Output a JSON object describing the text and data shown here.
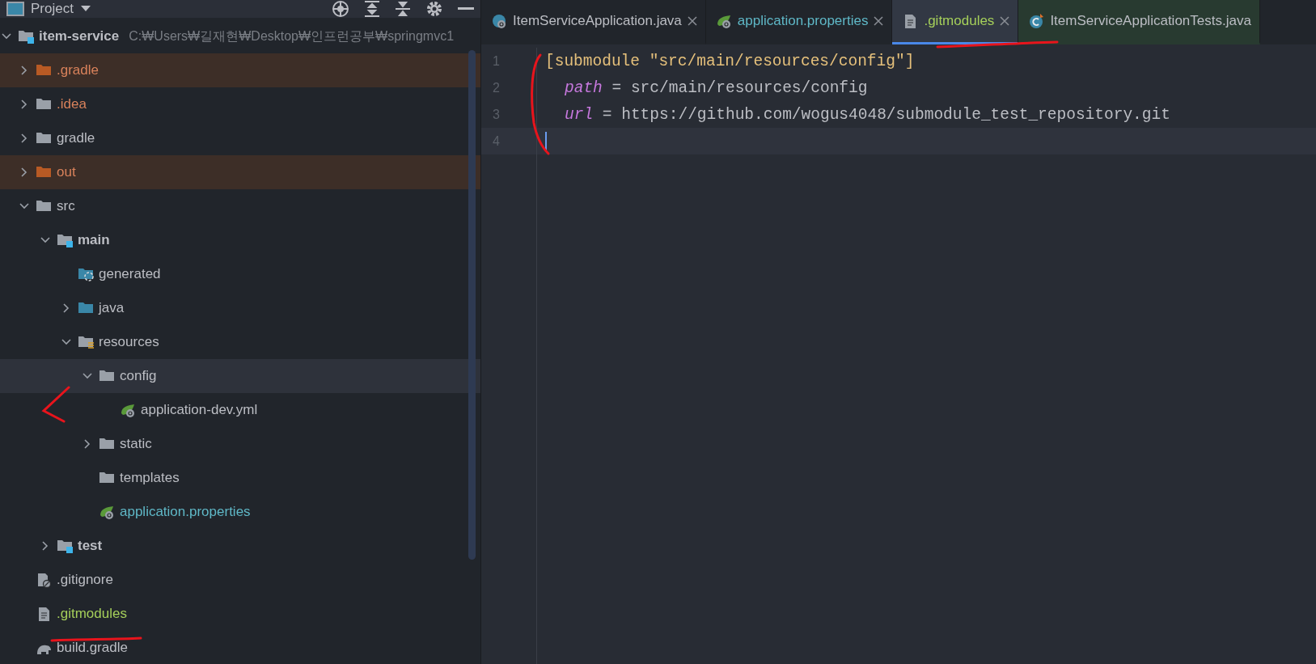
{
  "project_panel": {
    "title": "Project",
    "tree": [
      {
        "name": "item-service",
        "kind": "module",
        "hint": "C:₩Users₩길재현₩Desktop₩인프런공부₩springmvc1",
        "expanded": true,
        "selected": false,
        "excluded": false,
        "color": "#bcbec4",
        "children": [
          {
            "name": ".gradle",
            "kind": "excluded-folder",
            "expanded": false,
            "selected": false,
            "excluded": true,
            "color": "#d9825b"
          },
          {
            "name": ".idea",
            "kind": "folder",
            "expanded": false,
            "selected": false,
            "excluded": false,
            "color": "#d9825b"
          },
          {
            "name": "gradle",
            "kind": "folder",
            "expanded": false,
            "selected": false,
            "excluded": false,
            "color": "#bcbec4"
          },
          {
            "name": "out",
            "kind": "excluded-folder",
            "expanded": false,
            "selected": false,
            "excluded": true,
            "color": "#d9825b"
          },
          {
            "name": "src",
            "kind": "folder",
            "expanded": true,
            "selected": false,
            "excluded": false,
            "color": "#bcbec4",
            "children": [
              {
                "name": "main",
                "kind": "module",
                "expanded": true,
                "selected": false,
                "excluded": false,
                "color": "#bcbec4",
                "children": [
                  {
                    "name": "generated",
                    "kind": "generated-folder",
                    "selected": false,
                    "excluded": false,
                    "color": "#bcbec4"
                  },
                  {
                    "name": "java",
                    "kind": "source-folder",
                    "expanded": false,
                    "selected": false,
                    "excluded": false,
                    "color": "#bcbec4"
                  },
                  {
                    "name": "resources",
                    "kind": "resource-folder",
                    "expanded": true,
                    "selected": false,
                    "excluded": false,
                    "color": "#bcbec4",
                    "children": [
                      {
                        "name": "config",
                        "kind": "folder",
                        "expanded": true,
                        "selected": true,
                        "excluded": false,
                        "color": "#bcbec4",
                        "children": [
                          {
                            "name": "application-dev.yml",
                            "kind": "spring-file",
                            "selected": false,
                            "excluded": false,
                            "color": "#bcbec4"
                          }
                        ]
                      },
                      {
                        "name": "static",
                        "kind": "folder",
                        "expanded": false,
                        "selected": false,
                        "excluded": false,
                        "color": "#bcbec4"
                      },
                      {
                        "name": "templates",
                        "kind": "folder",
                        "selected": false,
                        "excluded": false,
                        "color": "#bcbec4"
                      },
                      {
                        "name": "application.properties",
                        "kind": "spring-file",
                        "selected": false,
                        "excluded": false,
                        "color": "#5fb8c7"
                      }
                    ]
                  }
                ]
              },
              {
                "name": "test",
                "kind": "module",
                "expanded": false,
                "selected": false,
                "excluded": false,
                "color": "#bcbec4"
              }
            ]
          },
          {
            "name": ".gitignore",
            "kind": "gitignore-file",
            "selected": false,
            "excluded": false,
            "color": "#bcbec4"
          },
          {
            "name": ".gitmodules",
            "kind": "text-file",
            "selected": false,
            "excluded": false,
            "color": "#a5cf5a"
          },
          {
            "name": "build.gradle",
            "kind": "gradle-file",
            "selected": false,
            "excluded": false,
            "color": "#bcbec4"
          }
        ]
      }
    ]
  },
  "editor": {
    "tabs": [
      {
        "label": "ItemServiceApplication.java",
        "kind": "java-class",
        "selected": false,
        "color": "#bcbec4"
      },
      {
        "label": "application.properties",
        "kind": "spring-file",
        "selected": false,
        "color": "#5fb8c7"
      },
      {
        "label": ".gitmodules",
        "kind": "text-file",
        "selected": true,
        "color": "#a5cf5a"
      },
      {
        "label": "ItemServiceApplicationTests.java",
        "kind": "test-class",
        "selected": false,
        "color": "#bcbec4"
      }
    ],
    "lines": [
      {
        "number": "1",
        "current": false,
        "tokens": [
          {
            "kind": "section",
            "text": "[submodule \"src/main/resources/config\"]"
          }
        ]
      },
      {
        "number": "2",
        "current": false,
        "tokens": [
          {
            "kind": "key",
            "text": "path"
          },
          {
            "kind": "plain",
            "text": " = src/main/resources/config"
          }
        ]
      },
      {
        "number": "3",
        "current": false,
        "tokens": [
          {
            "kind": "key",
            "text": "url"
          },
          {
            "kind": "plain",
            "text": " = https://github.com/wogus4048/submodule_test_repository.git"
          }
        ]
      },
      {
        "number": "4",
        "current": true
      }
    ]
  }
}
